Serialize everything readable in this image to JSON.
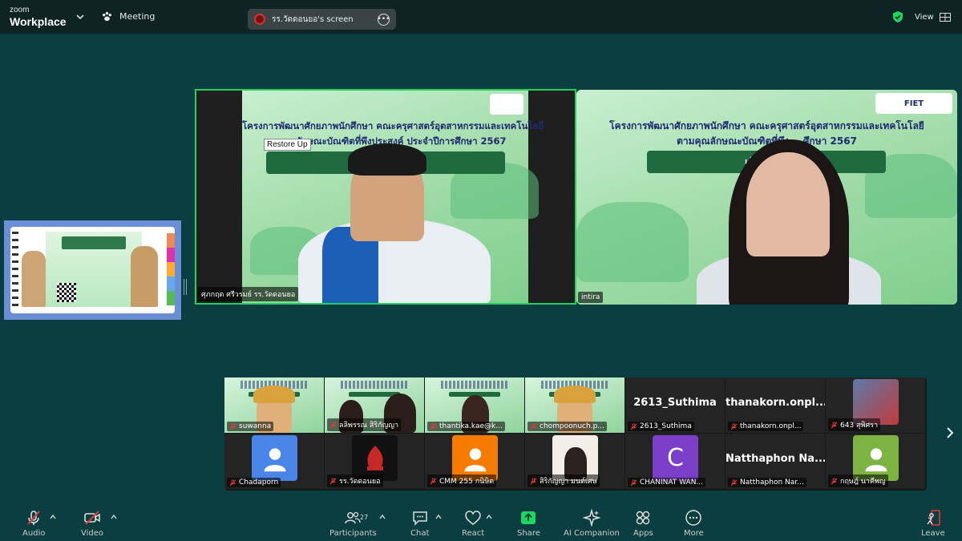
{
  "topbar": {
    "brand_line1": "zoom",
    "brand_line2": "Workplace",
    "meeting_label": "Meeting",
    "screen_label": "รร.วัดดอนยอ's screen",
    "view_label": "View"
  },
  "main": {
    "left_tile": {
      "name": "ศุภกฤต ศรีวรมย์ รร.วัดดอนยอ",
      "tooltip": "Restore Up",
      "slide_line1": "โครงการพัฒนาศักยภาพนักศึกษา คณะครุศาสตร์อุตสาหกรรมและเทคโนโลยี",
      "slide_line2": "ตามคุณลักษณะบัณฑิตที่พึงประสงค์ ประจำปีการศึกษา 2567",
      "slide_pill": "เส้นทาง... \"ครู\""
    },
    "right_tile": {
      "name": "intira",
      "slide_line1": "โครงการพัฒนาศักยภาพนักศึกษา คณะครุศาสตร์อุตสาหกรรมและเทคโนโลยี",
      "slide_line2": "ตามคุณลักษณะบัณฑิตที่พึง... ศึกษา 2567",
      "slide_pill": "เส้นทาง...",
      "logo_text": "FIET"
    }
  },
  "gallery": {
    "row1": [
      {
        "name": "suwanna",
        "kind": "slide-avatar"
      },
      {
        "name": "ลลิพรรณ สิริกัญญา",
        "kind": "slide-two"
      },
      {
        "name": "thantika.kae@k...",
        "kind": "slide-person"
      },
      {
        "name": "chompoonuch.p...",
        "kind": "slide-avatar"
      },
      {
        "name": "2613_Suthima",
        "big": "2613_Suthima",
        "kind": "name"
      },
      {
        "name": "thanakorn.onpl...",
        "big": "thanakorn.onpl...",
        "kind": "name"
      },
      {
        "name": "643 สุพิศรา",
        "kind": "photo"
      }
    ],
    "row2": [
      {
        "name": "Chadaporn",
        "kind": "default-avatar",
        "color": "#4a86e8"
      },
      {
        "name": "รร.วัดดอนยอ",
        "kind": "logo"
      },
      {
        "name": "CMM 255 กนิษิต",
        "kind": "default-avatar",
        "color": "#f57c00"
      },
      {
        "name": "สิริกัญญา มนต์เศษ",
        "kind": "photo-girl"
      },
      {
        "name": "CHANINAT WAN...",
        "kind": "letter",
        "letter": "C",
        "color": "#7b3fc7"
      },
      {
        "name": "Natthaphon Nar...",
        "big": "Natthaphon Na...",
        "kind": "name"
      },
      {
        "name": "กฤษฎ์ นาคีพญ",
        "kind": "default-avatar",
        "color": "#7cb342"
      }
    ]
  },
  "toolbar": {
    "audio": "Audio",
    "video": "Video",
    "participants": "Participants",
    "participants_count": "27",
    "chat": "Chat",
    "react": "React",
    "share": "Share",
    "ai_companion": "AI Companion",
    "apps": "Apps",
    "more": "More",
    "leave": "Leave"
  },
  "colors": {
    "active_speaker_border": "#22d160",
    "share_icon": "#1ed760",
    "mic_off": "#e53935",
    "background": "#0b3e40"
  }
}
